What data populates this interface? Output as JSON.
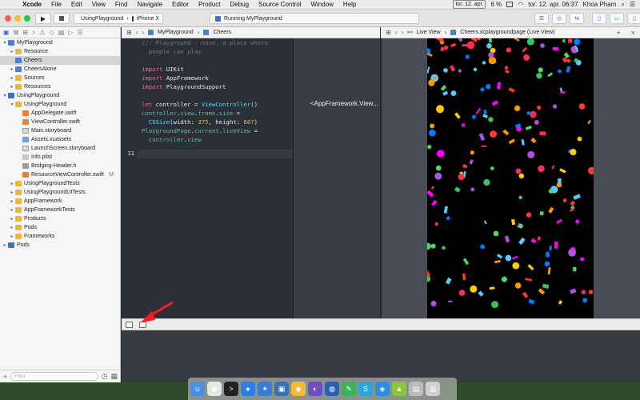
{
  "menubar": {
    "items": [
      "Xcode",
      "File",
      "Edit",
      "View",
      "Find",
      "Navigate",
      "Editor",
      "Product",
      "Debug",
      "Source Control",
      "Window",
      "Help"
    ],
    "date_badge": "tor. 12. apr.",
    "battery": "6 %",
    "clock": "tor. 12. apr.  06:37",
    "user": "Khoa Pham"
  },
  "toolbar": {
    "scheme": "UsingPlayground",
    "device": "iPhone X",
    "status": "Running MyPlayground"
  },
  "navigator": {
    "filter_placeholder": "Filter",
    "rows": [
      {
        "label": "MyPlayground",
        "depth": 0,
        "disc": "▾",
        "icon": "fpg",
        "name": "nav-item-myplayground",
        "badge": ""
      },
      {
        "label": "Resource",
        "depth": 1,
        "disc": "▸",
        "icon": "folder",
        "name": "nav-item-resource",
        "badge": ""
      },
      {
        "label": "Cheers",
        "depth": 1,
        "disc": "",
        "icon": "fpg",
        "name": "nav-item-cheers",
        "badge": "",
        "selected": true
      },
      {
        "label": "CheersAlone",
        "depth": 1,
        "disc": "▸",
        "icon": "fpg",
        "name": "nav-item-cheersalone",
        "badge": ""
      },
      {
        "label": "Sources",
        "depth": 1,
        "disc": "▸",
        "icon": "folder",
        "name": "nav-item-sources",
        "badge": ""
      },
      {
        "label": "Resources",
        "depth": 1,
        "disc": "▸",
        "icon": "folder",
        "name": "nav-item-resources",
        "badge": ""
      },
      {
        "label": "UsingPlayground",
        "depth": 0,
        "disc": "▾",
        "icon": "fproj",
        "name": "nav-item-usingplayground-project",
        "badge": ""
      },
      {
        "label": "UsingPlayground",
        "depth": 1,
        "disc": "▾",
        "icon": "folder",
        "name": "nav-item-usingplayground-group",
        "badge": ""
      },
      {
        "label": "AppDelegate.swift",
        "depth": 2,
        "disc": "",
        "icon": "fsw",
        "name": "nav-item-appdelegate",
        "badge": ""
      },
      {
        "label": "ViewController.swift",
        "depth": 2,
        "disc": "",
        "icon": "fsw",
        "name": "nav-item-viewcontroller",
        "badge": ""
      },
      {
        "label": "Main.storyboard",
        "depth": 2,
        "disc": "",
        "icon": "fsb",
        "name": "nav-item-main-storyboard",
        "badge": ""
      },
      {
        "label": "Assets.xcassets",
        "depth": 2,
        "disc": "",
        "icon": "fas",
        "name": "nav-item-assets",
        "badge": ""
      },
      {
        "label": "LaunchScreen.storyboard",
        "depth": 2,
        "disc": "",
        "icon": "fsb",
        "name": "nav-item-launchscreen",
        "badge": ""
      },
      {
        "label": "Info.plist",
        "depth": 2,
        "disc": "",
        "icon": "fpl",
        "name": "nav-item-info-plist",
        "badge": ""
      },
      {
        "label": "Bridging-Header.h",
        "depth": 2,
        "disc": "",
        "icon": "fh",
        "name": "nav-item-bridging-header",
        "badge": ""
      },
      {
        "label": "ResourceViewController.swift",
        "depth": 2,
        "disc": "",
        "icon": "fsw",
        "name": "nav-item-resourceviewcontroller",
        "badge": "M"
      },
      {
        "label": "UsingPlaygroundTests",
        "depth": 1,
        "disc": "▸",
        "icon": "folder",
        "name": "nav-item-tests",
        "badge": ""
      },
      {
        "label": "UsingPlaygroundUITests",
        "depth": 1,
        "disc": "▸",
        "icon": "folder",
        "name": "nav-item-uitests",
        "badge": ""
      },
      {
        "label": "AppFramework",
        "depth": 1,
        "disc": "▸",
        "icon": "folder",
        "name": "nav-item-appframework",
        "badge": ""
      },
      {
        "label": "AppFrameworkTests",
        "depth": 1,
        "disc": "▸",
        "icon": "folder",
        "name": "nav-item-appframeworktests",
        "badge": ""
      },
      {
        "label": "Products",
        "depth": 1,
        "disc": "▸",
        "icon": "folder",
        "name": "nav-item-products",
        "badge": ""
      },
      {
        "label": "Pods",
        "depth": 1,
        "disc": "▸",
        "icon": "folder",
        "name": "nav-item-pods-group",
        "badge": ""
      },
      {
        "label": "Frameworks",
        "depth": 1,
        "disc": "▸",
        "icon": "folder",
        "name": "nav-item-frameworks",
        "badge": ""
      },
      {
        "label": "Pods",
        "depth": 0,
        "disc": "▸",
        "icon": "fproj",
        "name": "nav-item-pods-project",
        "badge": ""
      }
    ]
  },
  "editor": {
    "breadcrumb": [
      "MyPlayground",
      "Cheers"
    ],
    "line_numbers": [
      "",
      "",
      "",
      "",
      "",
      "",
      "",
      "",
      "",
      "",
      "11"
    ],
    "lines": [
      [
        {
          "t": "//: Playground - noun: a place where",
          "c": "cm"
        }
      ],
      [
        {
          "t": "  people can play",
          "c": "cm"
        }
      ],
      [
        {
          "t": "",
          "c": ""
        }
      ],
      [
        {
          "t": "import ",
          "c": "kw"
        },
        {
          "t": "UIKit",
          "c": ""
        }
      ],
      [
        {
          "t": "import ",
          "c": "kw"
        },
        {
          "t": "AppFramework",
          "c": ""
        }
      ],
      [
        {
          "t": "import ",
          "c": "kw"
        },
        {
          "t": "PlaygroundSupport",
          "c": ""
        }
      ],
      [
        {
          "t": "",
          "c": ""
        }
      ],
      [
        {
          "t": "let ",
          "c": "kw"
        },
        {
          "t": "controller = ",
          "c": ""
        },
        {
          "t": "ViewController",
          "c": "ty"
        },
        {
          "t": "()",
          "c": ""
        }
      ],
      [
        {
          "t": "controller",
          "c": "cl"
        },
        {
          "t": ".",
          "c": ""
        },
        {
          "t": "view",
          "c": "cl"
        },
        {
          "t": ".",
          "c": ""
        },
        {
          "t": "frame",
          "c": "cl"
        },
        {
          "t": ".",
          "c": ""
        },
        {
          "t": "size",
          "c": "cl"
        },
        {
          "t": " =",
          "c": ""
        }
      ],
      [
        {
          "t": "  ",
          "c": ""
        },
        {
          "t": "CGSize",
          "c": "ty"
        },
        {
          "t": "(width: ",
          "c": ""
        },
        {
          "t": "375",
          "c": "nm"
        },
        {
          "t": ", height: ",
          "c": ""
        },
        {
          "t": "667",
          "c": "nm"
        },
        {
          "t": ")",
          "c": ""
        }
      ],
      [
        {
          "t": "PlaygroundPage",
          "c": "cl"
        },
        {
          "t": ".",
          "c": ""
        },
        {
          "t": "current",
          "c": "cl"
        },
        {
          "t": ".",
          "c": ""
        },
        {
          "t": "liveView",
          "c": "cl"
        },
        {
          "t": " =",
          "c": ""
        }
      ],
      [
        {
          "t": "  ",
          "c": ""
        },
        {
          "t": "controller",
          "c": "cl"
        },
        {
          "t": ".",
          "c": ""
        },
        {
          "t": "view",
          "c": "cl"
        }
      ],
      [
        {
          "t": "",
          "c": ""
        }
      ],
      [
        {
          "t": "",
          "c": ""
        }
      ]
    ],
    "result_value": "<AppFramework.View..."
  },
  "assistant": {
    "breadcrumb": [
      "Live View",
      "Cheers.xcplaygroundpage (Live View)"
    ]
  },
  "dock": {
    "apps": [
      {
        "name": "finder-dock-icon",
        "color": "#4a8fe0",
        "glyph": "☺"
      },
      {
        "name": "chrome-dock-icon",
        "color": "#e6e6e6",
        "glyph": "◉"
      },
      {
        "name": "terminal-dock-icon",
        "color": "#222222",
        "glyph": ">"
      },
      {
        "name": "maps-dock-icon",
        "color": "#2f7de1",
        "glyph": "●"
      },
      {
        "name": "xcode-dock-icon",
        "color": "#3a7bd5",
        "glyph": "✦"
      },
      {
        "name": "simulator-dock-icon",
        "color": "#3b6fb5",
        "glyph": "▣"
      },
      {
        "name": "sketch-dock-icon",
        "color": "#f5b93a",
        "glyph": "◆"
      },
      {
        "name": "firefox-dock-icon",
        "color": "#6d4fc2",
        "glyph": "◐"
      },
      {
        "name": "app-store-dock-icon",
        "color": "#2d5fb0",
        "glyph": "◍"
      },
      {
        "name": "evernote-dock-icon",
        "color": "#3bb15a",
        "glyph": "✎"
      },
      {
        "name": "skype-dock-icon",
        "color": "#2aa7d8",
        "glyph": "S"
      },
      {
        "name": "safari-dock-icon",
        "color": "#2f8de0",
        "glyph": "◈"
      },
      {
        "name": "android-dock-icon",
        "color": "#8cc63f",
        "glyph": "▲"
      },
      {
        "name": "documents-dock-icon",
        "color": "#bbbbbb",
        "glyph": "▤"
      },
      {
        "name": "trash-dock-icon",
        "color": "#cfcfcf",
        "glyph": "▥"
      }
    ]
  },
  "colors": {
    "accent": "#2f6bd9",
    "editor_bg": "#2b2f37",
    "annotation_arrow": "#ff1a1a"
  }
}
